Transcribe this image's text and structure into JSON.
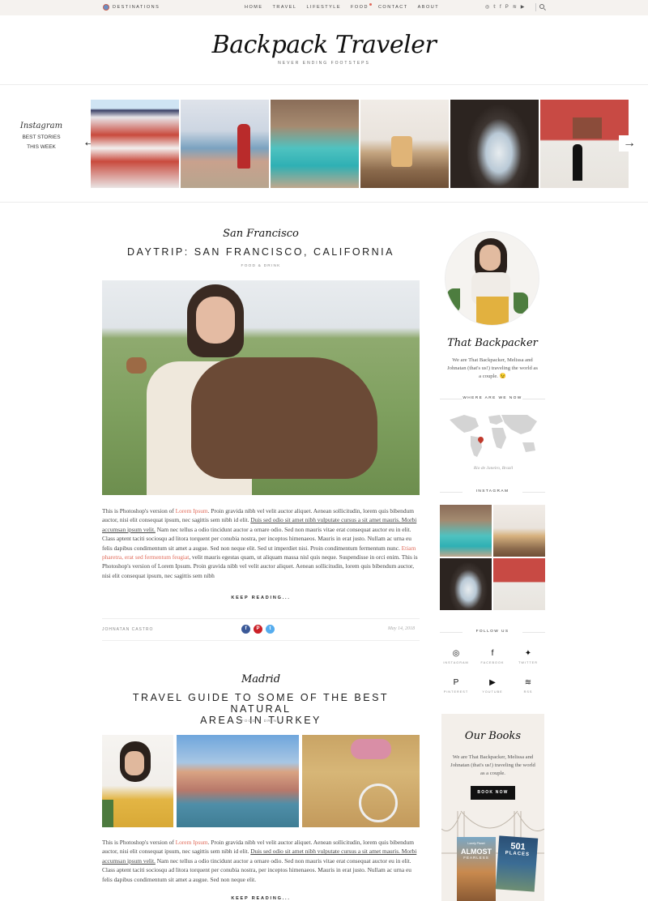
{
  "topbar": {
    "destinations": "DESTINATIONS",
    "nav": [
      "HOME",
      "TRAVEL",
      "LIFESTYLE",
      "FOOD",
      "CONTACT",
      "ABOUT"
    ],
    "social_icons": [
      "instagram-icon",
      "twitter-icon",
      "facebook-icon",
      "pinterest-icon",
      "rss-icon",
      "youtube-icon"
    ]
  },
  "header": {
    "logo": "Backpack Traveler",
    "tagline": "NEVER ENDING FOOTSTEPS"
  },
  "instagram_strip": {
    "script": "Instagram",
    "label_line1": "BEST STORIES",
    "label_line2": "THIS WEEK"
  },
  "post1": {
    "category_script": "San Francisco",
    "title": "DAYTRIP: SAN FRANCISCO, CALIFORNIA",
    "subcategory": "FOOD & DRINK",
    "body_1": "This is Photoshop's version  of ",
    "body_link1": "Lorem Ipsum",
    "body_2": ". Proin gravida nibh vel velit auctor aliquet. Aenean sollicitudin, lorem quis bibendum auctor, nisi elit consequat ipsum, nec sagittis sem nibh id elit. ",
    "body_ul": "Duis sed odio sit amet nibh vulputate cursus a sit amet mauris. Morbi accumsan ipsum velit.",
    "body_3": " Nam nec tellus a odio tincidunt auctor a ornare odio. Sed non  mauris vitae erat consequat auctor eu in elit. Class aptent taciti sociosqu ad litora torquent per conubia nostra, per inceptos himenaeos. Mauris in erat justo. Nullam ac urna eu felis dapibus condimentum sit amet a augue. Sed non neque elit. Sed ut imperdiet nisi. Proin condimentum fermentum nunc. ",
    "body_link2": "Etiam pharetra, erat sed fermentum feugiat",
    "body_4": ", velit mauris egestas quam, ut aliquam massa nisl quis neque. Suspendisse in orci enim. This is Photoshop's version  of Lorem Ipsum. Proin gravida nibh vel velit auctor aliquet. Aenean sollicitudin, lorem quis bibendum auctor, nisi elit consequat ipsum, nec sagittis sem nibh",
    "keep_reading": "KEEP READING...",
    "author": "JOHNATAN CASTRO",
    "date": "May 14, 2018"
  },
  "post2": {
    "category_script": "Madrid",
    "title_line1": "TRAVEL GUIDE TO SOME OF THE BEST NATURAL",
    "title_line2": "AREAS IN TURKEY",
    "subcategory": "FOOD & DRINK",
    "body_1": "This is Photoshop's version  of ",
    "body_link1": "Lorem Ipsum",
    "body_2": ". Proin gravida nibh vel velit auctor aliquet. Aenean sollicitudin, lorem quis bibendum auctor, nisi elit consequat ipsum, nec sagittis sem nibh id elit. ",
    "body_ul": "Duis sed odio sit amet nibh vulputate cursus a sit amet mauris. Morbi accumsan ipsum velit.",
    "body_3": " Nam nec tellus a odio tincidunt auctor a ornare odio. Sed non  mauris vitae erat consequat auctor eu in elit. Class aptent taciti sociosqu ad litora torquent per conubia nostra, per inceptos himenaeos. Mauris in erat justo. Nullam ac urna eu felis dapibus condimentum sit amet a augue. Sed non neque elit.",
    "keep_reading": "KEEP READING..."
  },
  "sidebar": {
    "about_script": "That Backpacker",
    "about_text": "We are That Backpacker, Melissa and Johnatan (that's us!) traveling the world as a couple. 😉",
    "where_title": "WHERE ARE WE NOW",
    "location": "Rio de Janeiro, Brazil",
    "instagram_title": "INSTAGRAM",
    "follow_title": "FOLLOW US",
    "follow": [
      "INSTAGRAM",
      "FACEBOOK",
      "TWITTER",
      "PINTEREST",
      "YOUTUBE",
      "RSS"
    ],
    "books_script": "Our Books",
    "books_text": "We are That Backpacker, Melissa and Johnatan (that's us!) traveling the world as a couple.",
    "book_now": "BOOK NOW",
    "book1_small": "Lonely Planet",
    "book1_big": "ALMOST",
    "book1_sub": "FEARLESS",
    "book2_big": "501",
    "book2_sub": "PLACES"
  },
  "colors": {
    "accent": "#e06b5a",
    "topbar_bg": "#f5f2ef",
    "books_bg": "#f3efea",
    "facebook": "#3b5998",
    "pinterest": "#cb2027",
    "twitter": "#55acee"
  }
}
